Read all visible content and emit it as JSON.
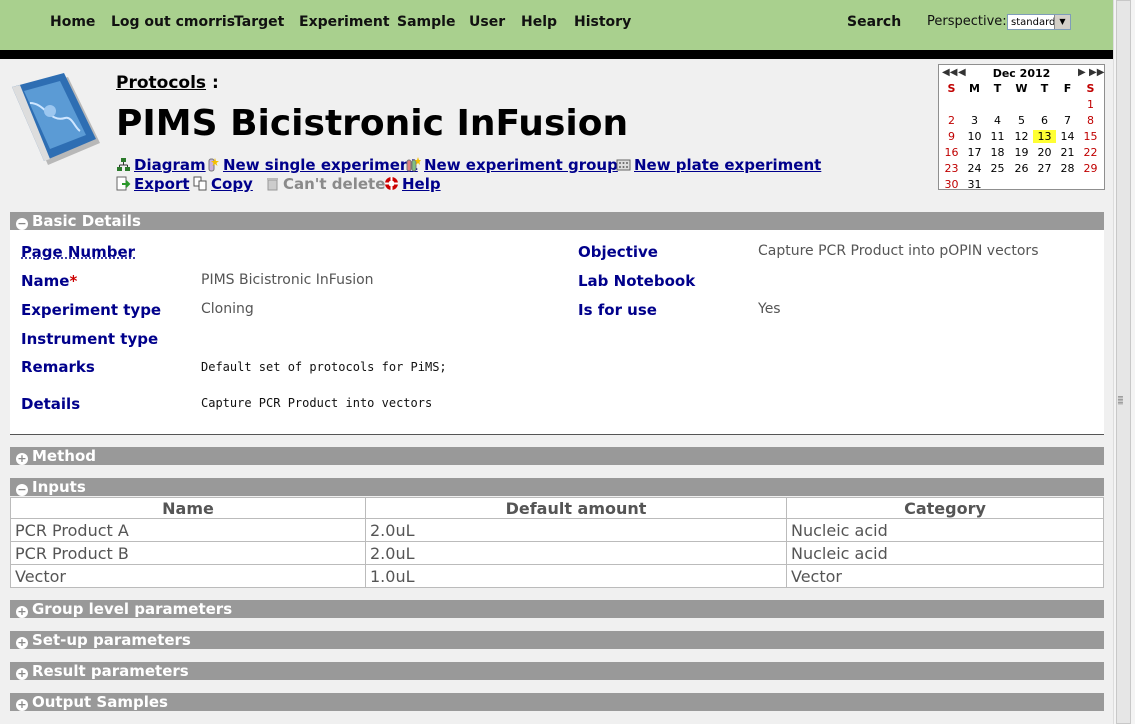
{
  "nav": {
    "items": [
      "Home",
      "Log out cmorris",
      "Target",
      "Experiment",
      "Sample",
      "User",
      "Help",
      "History"
    ],
    "search": "Search",
    "perspective_label": "Perspective:",
    "perspective_value": "standard"
  },
  "header": {
    "breadcrumb": "Protocols",
    "breadcrumb_sep": ":",
    "title": "PIMS Bicistronic InFusion",
    "actions": {
      "diagram": "Diagram",
      "new_single": "New single experiment",
      "new_group": "New experiment group",
      "new_plate": "New plate experiment",
      "export": "Export",
      "copy": "Copy",
      "cant_delete": "Can't delete",
      "help": "Help"
    }
  },
  "calendar": {
    "title": "Dec 2012",
    "dow": [
      "S",
      "M",
      "T",
      "W",
      "T",
      "F",
      "S"
    ],
    "weeks": [
      [
        "",
        "",
        "",
        "",
        "",
        "",
        "1"
      ],
      [
        "2",
        "3",
        "4",
        "5",
        "6",
        "7",
        "8"
      ],
      [
        "9",
        "10",
        "11",
        "12",
        "13",
        "14",
        "15"
      ],
      [
        "16",
        "17",
        "18",
        "19",
        "20",
        "21",
        "22"
      ],
      [
        "23",
        "24",
        "25",
        "26",
        "27",
        "28",
        "29"
      ],
      [
        "30",
        "31",
        "",
        "",
        "",
        "",
        ""
      ]
    ],
    "today": "13",
    "highlight_color": "#ffff33"
  },
  "basic": {
    "section_label": "Basic Details",
    "page_number_label": "Page Number",
    "name_label": "Name",
    "name_value": "PIMS Bicistronic InFusion",
    "experiment_type_label": "Experiment type",
    "experiment_type_value": "Cloning",
    "instrument_type_label": "Instrument type",
    "remarks_label": "Remarks",
    "remarks_value": "Default set of protocols for PiMS;",
    "details_label": "Details",
    "details_value": "Capture PCR Product into vectors",
    "objective_label": "Objective",
    "objective_value": "Capture PCR Product into pOPIN vectors",
    "lab_notebook_label": "Lab Notebook",
    "is_for_use_label": "Is for use",
    "is_for_use_value": "Yes"
  },
  "sections": {
    "method": "Method",
    "inputs": "Inputs",
    "group_params": "Group level parameters",
    "setup_params": "Set-up parameters",
    "result_params": "Result parameters",
    "output_samples": "Output Samples"
  },
  "inputs_table": {
    "columns": [
      "Name",
      "Default amount",
      "Category"
    ],
    "rows": [
      [
        "PCR Product A",
        "2.0uL",
        "Nucleic acid"
      ],
      [
        "PCR Product B",
        "2.0uL",
        "Nucleic acid"
      ],
      [
        "Vector",
        "1.0uL",
        "Vector"
      ]
    ]
  },
  "colors": {
    "nav_bg": "#a9d08e",
    "section_bar": "#999999",
    "label_blue": "#00008b",
    "calendar_weekend": "#c00000"
  }
}
